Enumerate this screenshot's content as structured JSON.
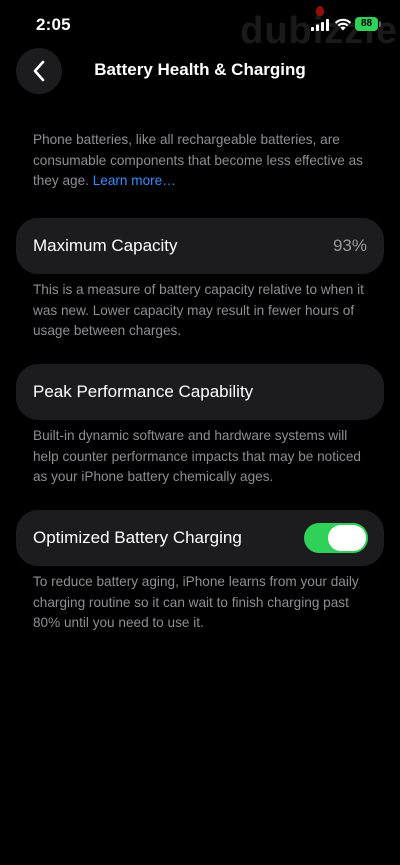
{
  "status_bar": {
    "time": "2:05",
    "battery_level": "88",
    "watermark": "dubizzle",
    "icons": [
      "signal-icon",
      "wifi-icon",
      "battery-icon"
    ]
  },
  "nav": {
    "title": "Battery Health & Charging",
    "back_icon": "chevron-left-icon"
  },
  "intro": {
    "text": "Phone batteries, like all rechargeable batteries, are consumable components that become less effective as they age. ",
    "link": "Learn more…"
  },
  "maximum_capacity": {
    "label": "Maximum Capacity",
    "value": "93%",
    "description": "This is a measure of battery capacity relative to when it was new. Lower capacity may result in fewer hours of usage between charges."
  },
  "peak_performance": {
    "label": "Peak Performance Capability",
    "description": "Built-in dynamic software and hardware systems will help counter performance impacts that may be noticed as your iPhone battery chemically ages."
  },
  "optimized_charging": {
    "label": "Optimized Battery Charging",
    "enabled": true,
    "description": "To reduce battery aging, iPhone learns from your daily charging routine so it can wait to finish charging past 80% until you need to use it."
  },
  "colors": {
    "accent_link": "#3a8bff",
    "toggle_on": "#30d158",
    "card_bg": "#1c1c1e",
    "secondary_text": "#8e8e93"
  }
}
